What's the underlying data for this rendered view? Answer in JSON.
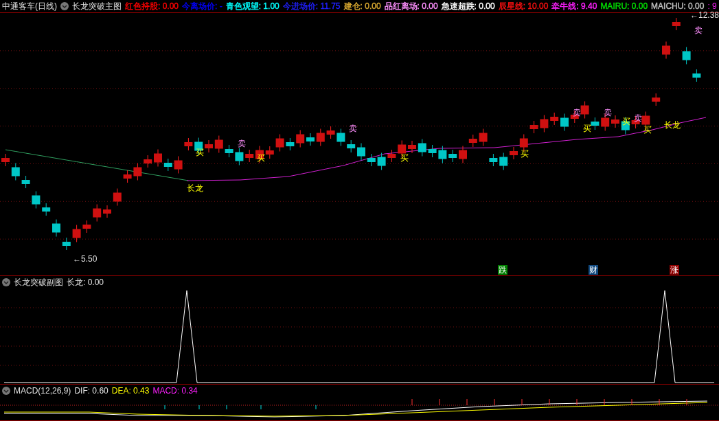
{
  "main_pane": {
    "stock_title": "中通客车(日线)",
    "indicator_title": "长龙突破主图",
    "indicators": [
      {
        "text": "红色持股: 0.00",
        "color": "#ff0000"
      },
      {
        "text": "今离场价: -",
        "color": "#0000ff"
      },
      {
        "text": "青色观望: 1.00",
        "color": "#00ffff"
      },
      {
        "text": "今进场价: 11.75",
        "color": "#2020ff"
      },
      {
        "text": "建仓: 0.00",
        "color": "#d8a830"
      },
      {
        "text": "品红离场: 0.00",
        "color": "#ff90ff"
      },
      {
        "text": "急速超跌: 0.00",
        "color": "#ffffff"
      },
      {
        "text": "辰星线: 10.00",
        "color": "#ff1010"
      },
      {
        "text": "牵牛线: 9.40",
        "color": "#ff20ff"
      },
      {
        "text": "MAIRU: 0.00",
        "color": "#00e000"
      },
      {
        "text": "MAICHU: 0.00",
        "color": "#c0c0c0"
      }
    ],
    "cut_off_text": ": 9",
    "annotations": [
      {
        "kind": "low",
        "text": "←5.50"
      },
      {
        "kind": "dragon",
        "text": "长龙"
      },
      {
        "kind": "buy",
        "text": "买"
      },
      {
        "kind": "sell",
        "text": "卖"
      },
      {
        "kind": "buy",
        "text": "买"
      },
      {
        "kind": "sell",
        "text": "卖"
      },
      {
        "kind": "buy",
        "text": "买"
      },
      {
        "kind": "buy",
        "text": "买"
      },
      {
        "kind": "sell",
        "text": "卖"
      },
      {
        "kind": "buy",
        "text": "买"
      },
      {
        "kind": "sell",
        "text": "卖"
      },
      {
        "kind": "buy",
        "text": "买"
      },
      {
        "kind": "sell",
        "text": "卖"
      },
      {
        "kind": "buy",
        "text": "买"
      },
      {
        "kind": "dragon",
        "text": "长龙"
      },
      {
        "kind": "high",
        "text": "←12.38"
      },
      {
        "kind": "sell",
        "text": "卖"
      }
    ],
    "badges": [
      {
        "text": "跌",
        "color": "#008000"
      },
      {
        "text": "财",
        "color": "#124a80"
      },
      {
        "text": "涨",
        "color": "#900000"
      }
    ]
  },
  "sub_pane": {
    "title": "长龙突破副图",
    "readings": [
      {
        "text": "长龙: 0.00",
        "color": "#e8e8e8"
      }
    ]
  },
  "macd_pane": {
    "title": "MACD(12,26,9)",
    "readings": [
      {
        "text": "DIF: 0.60",
        "color": "#e8e8e8"
      },
      {
        "text": "DEA: 0.43",
        "color": "#ffff00"
      },
      {
        "text": "MACD: 0.34",
        "color": "#ff20ff"
      }
    ]
  }
}
